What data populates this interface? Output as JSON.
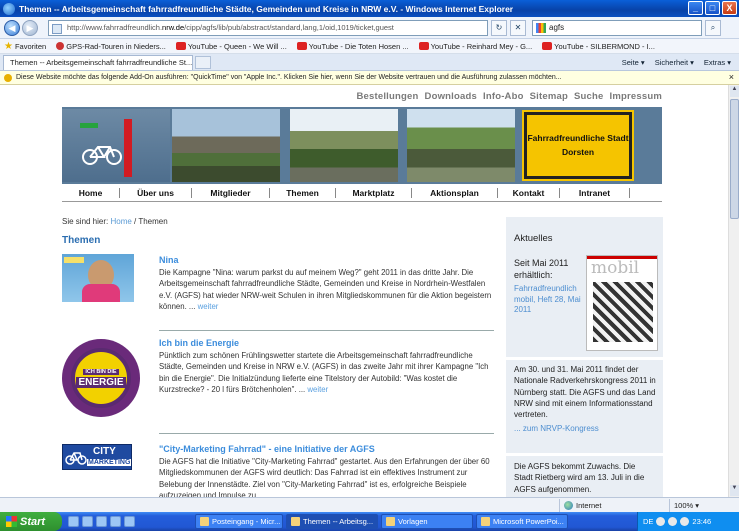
{
  "window": {
    "title": "Themen -- Arbeitsgemeinschaft fahrradfreundliche Städte, Gemeinden und Kreise in NRW e.V. - Windows Internet Explorer",
    "min": "_",
    "max": "□",
    "close": "X"
  },
  "address": {
    "url_prefix": "http://www.fahrradfreundlich.",
    "url_domain": "nrw.de",
    "url_suffix": "/cipp/agfs/lib/pub/abstract/standard,lang,1/oid,1019/ticket,guest",
    "refresh": "↻",
    "stop": "✕",
    "search_value": "agfs"
  },
  "favorites": {
    "label": "Favoriten",
    "items": [
      "GPS-Rad-Touren in Nieders...",
      "YouTube - Queen - We Will ...",
      "YouTube - Die Toten Hosen ...",
      "YouTube - Reinhard Mey - G...",
      "YouTube - SILBERMOND - I..."
    ]
  },
  "tab": {
    "label": "Themen -- Arbeitsgemeinschaft fahrradfreundliche St...",
    "cmd": [
      "Seite ▾",
      "Sicherheit ▾",
      "Extras ▾"
    ]
  },
  "infobar": {
    "text": "Diese Website möchte das folgende Add-On ausführen: \"QuickTime\" von \"Apple Inc.\". Klicken Sie hier, wenn Sie der Website vertrauen und die Ausführung zulassen möchten...",
    "close": "×"
  },
  "topnav": [
    "Bestellungen",
    "Downloads",
    "Info-Abo",
    "Sitemap",
    "Suche",
    "Impressum"
  ],
  "sign": {
    "line1": "Fahrradfreundliche Stadt",
    "line2": "Dorsten"
  },
  "mainnav": [
    "Home",
    "Über uns",
    "Mitglieder",
    "Themen",
    "Marktplatz",
    "Aktionsplan",
    "Kontakt",
    "Intranet"
  ],
  "breadcrumb": {
    "prefix": "Sie sind hier: ",
    "home": "Home",
    "sep": " / ",
    "current": "Themen"
  },
  "page_title": "Themen",
  "items": [
    {
      "title": "Nina",
      "text": "Die Kampagne \"Nina: warum parkst du auf meinem Weg?\" geht 2011 in das dritte Jahr. Die Arbeitsgemeinschaft fahrradfreundliche Städte, Gemeinden und Kreise in Nordrhein-Westfalen e.V. (AGFS) hat wieder NRW-weit Schulen in ihren Mitgliedskommunen für die Aktion begeistern können. ...",
      "more": "weiter"
    },
    {
      "title": "Ich bin die Energie",
      "text": "Pünktlich zum schönen Frühlingswetter startete die Arbeitsgemeinschaft fahrradfreundliche Städte, Gemeinden und Kreise in NRW e.V. (AGFS) in das zweite Jahr mit ihrer Kampagne \"Ich bin die Energie\". Die Initialzündung lieferte eine Titelstory der Autobild: \"Was kostet die Kurzstrecke? - 20 l fürs Brötchenholen\". ...",
      "more": "weiter",
      "badge_top": "ICH BIN DIE",
      "badge_main": "ENERGIE"
    },
    {
      "title": "\"City-Marketing Fahrrad\" - eine Initiative der AGFS",
      "text": "Die AGFS hat die Initiative \"City-Marketing Fahrrad\" gestartet. Aus den Erfahrungen der über 60 Mitgliedskommunen der AGFS wird deutlich: Das Fahrrad ist ein effektives Instrument zur Belebung der Innenstädte. Ziel von \"City-Marketing Fahrrad\" ist es, erfolgreiche Beispiele aufzuzeigen und Impulse zu",
      "logo1": "CITY",
      "logo2": "MARKETING"
    }
  ],
  "sidebar": {
    "heading": "Aktuelles",
    "since": "Seit Mai 2011 erhältlich:",
    "since_link": "Fahrradfreundlich mobil, Heft 28, Mai 2011",
    "mobil_title": "mobil",
    "news1": "Am 30. und 31. Mai 2011 findet der Nationale Radverkehrskongress 2011 in Nürnberg statt. Die AGFS und das Land NRW sind mit einem Informationsstand vertreten.",
    "news1_link": "... zum NRVP-Kongress",
    "news2": "Die AGFS bekommt Zuwachs. Die Stadt Rietberg wird am 13. Juli in die AGFS aufgenommen."
  },
  "status": {
    "zone": "Internet",
    "zoom": "100% ▾"
  },
  "taskbar": {
    "start": "Start",
    "tasks": [
      "Posteingang - Micr...",
      "Themen -- Arbeitsg...",
      "Vorlagen",
      "Microsoft PowerPoi..."
    ],
    "lang": "DE",
    "time": "23:46"
  }
}
